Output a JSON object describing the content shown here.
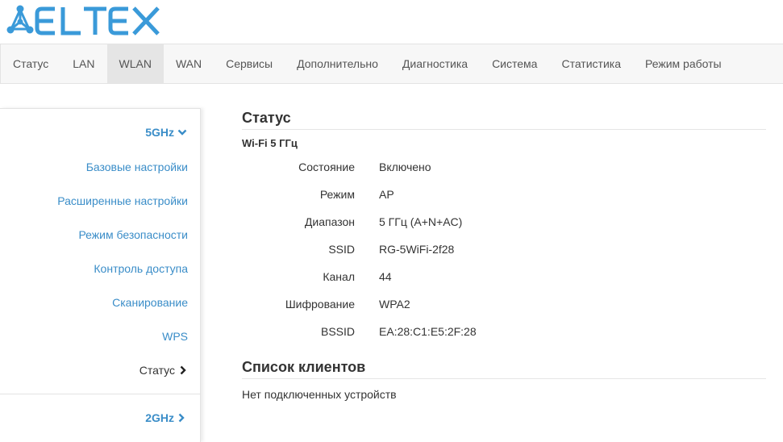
{
  "brand": {
    "name": "ELTEX",
    "color": "#3a9ad9"
  },
  "nav": {
    "items": [
      {
        "label": "Статус",
        "id": "status"
      },
      {
        "label": "LAN",
        "id": "lan"
      },
      {
        "label": "WLAN",
        "id": "wlan",
        "active": true
      },
      {
        "label": "WAN",
        "id": "wan"
      },
      {
        "label": "Сервисы",
        "id": "services"
      },
      {
        "label": "Дополнительно",
        "id": "advanced"
      },
      {
        "label": "Диагностика",
        "id": "diagnostics"
      },
      {
        "label": "Система",
        "id": "system"
      },
      {
        "label": "Статистика",
        "id": "statistics"
      },
      {
        "label": "Режим работы",
        "id": "mode"
      }
    ]
  },
  "sidebar": {
    "group_5ghz": "5GHz",
    "group_2ghz": "2GHz",
    "items": [
      {
        "label": "Базовые настройки"
      },
      {
        "label": "Расширенные настройки"
      },
      {
        "label": "Режим безопасности"
      },
      {
        "label": "Контроль доступа"
      },
      {
        "label": "Сканирование"
      },
      {
        "label": "WPS"
      },
      {
        "label": "Статус",
        "current": true
      }
    ]
  },
  "main": {
    "title": "Статус",
    "subtitle": "Wi-Fi 5 ГГц",
    "fields": [
      {
        "key": "Состояние",
        "value": "Включено"
      },
      {
        "key": "Режим",
        "value": "AP"
      },
      {
        "key": "Диапазон",
        "value": "5 ГГц (A+N+AC)"
      },
      {
        "key": "SSID",
        "value": "RG-5WiFi-2f28"
      },
      {
        "key": "Канал",
        "value": "44"
      },
      {
        "key": "Шифрование",
        "value": "WPA2"
      },
      {
        "key": "BSSID",
        "value": "EA:28:C1:E5:2F:28"
      }
    ],
    "clients_title": "Список клиентов",
    "clients_empty": "Нет подключенных устройств"
  },
  "colors": {
    "link": "#3a8dc8",
    "active_tab": "#e5e5e5"
  }
}
